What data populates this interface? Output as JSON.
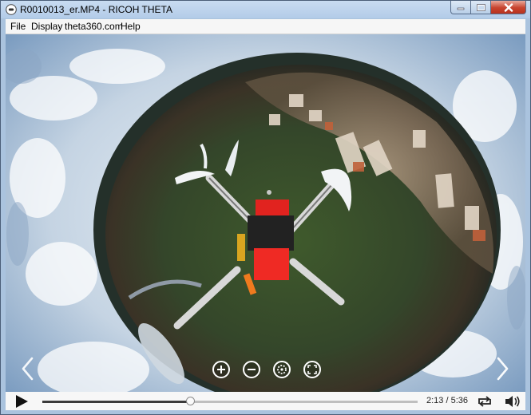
{
  "window": {
    "title": "R0010013_er.MP4 - RICOH THETA"
  },
  "menu": {
    "items": [
      "File",
      "Display",
      "theta360.com",
      "Help"
    ]
  },
  "player": {
    "time_display": "2:13 / 5:36",
    "progress": 0.395,
    "icons": {
      "prev": "chevron-left-icon",
      "next": "chevron-right-icon",
      "zoom_in": "zoom-in-icon",
      "zoom_out": "zoom-out-icon",
      "view_mode": "view-mode-icon",
      "fit": "fit-screen-icon",
      "play": "play-icon",
      "loop": "loop-icon",
      "volume": "volume-icon"
    }
  },
  "colors": {
    "titlebar": "#b8cfe8",
    "close": "#c7432e",
    "control_bar": "#f7f7f7"
  }
}
